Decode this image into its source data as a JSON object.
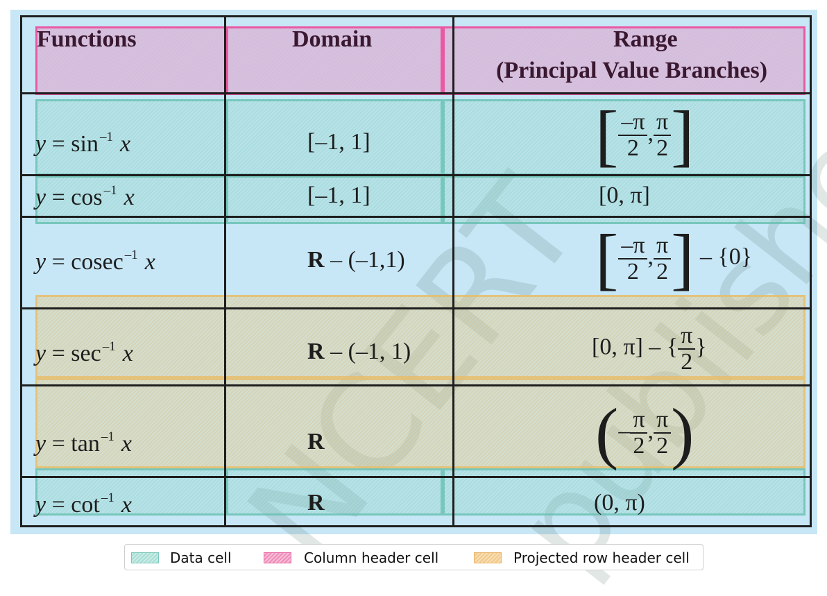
{
  "watermark": [
    "NCERT",
    "published"
  ],
  "table": {
    "headers": {
      "functions": "Functions",
      "domain": "Domain",
      "range_line1": "Range",
      "range_line2": "(Principal Value Branches)"
    },
    "rows": [
      {
        "fn": "sin",
        "domain": "[–1, 1]"
      },
      {
        "fn": "cos",
        "domain": "[–1, 1]",
        "range": "[0, π]"
      },
      {
        "fn": "cosec",
        "domain_bold": "R",
        "domain_rest": " – (–1,1)"
      },
      {
        "fn": "sec",
        "domain_bold": "R",
        "domain_rest": " – (–1, 1)"
      },
      {
        "fn": "tan",
        "domain_bold": "R"
      },
      {
        "fn": "cot",
        "domain_bold": "R",
        "range": "(0, π)"
      }
    ],
    "math": {
      "y": "y",
      "eq": " = ",
      "x": "x",
      "sup": "–1",
      "neg_pi": "–π",
      "pi": "π",
      "two": "2",
      "comma": ",",
      "minus": "–",
      "lbrack": "[",
      "rbrack": "]",
      "lparen": "(",
      "rparen": ")",
      "set_zero": " – {0}",
      "sec_range_prefix": "[0, π] – {",
      "rbrace": "}"
    }
  },
  "legend": {
    "items": [
      "Data cell",
      "Column header cell",
      "Projected row header cell"
    ],
    "colors": {
      "data": "#8fd3c7",
      "header": "#f08cb8",
      "row_header": "#f2c98a"
    }
  }
}
